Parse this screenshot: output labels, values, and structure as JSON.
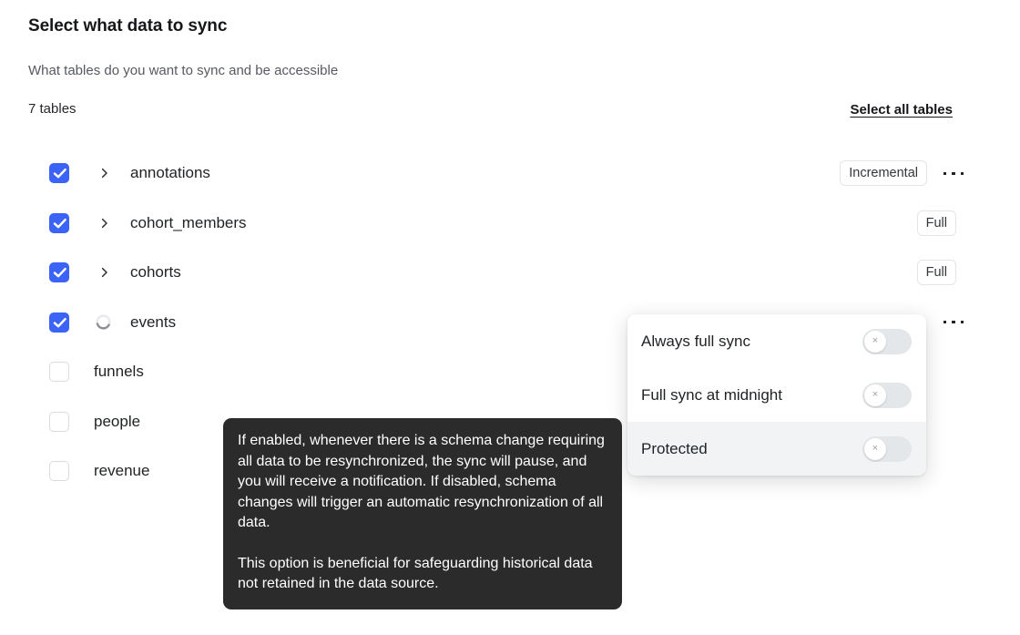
{
  "header": {
    "title": "Select what data to sync",
    "subtitle": "What tables do you want to sync and be accessible",
    "count_label": "7 tables",
    "select_all_label": "Select all tables"
  },
  "colors": {
    "checkbox_checked": "#3b63f6",
    "tooltip_bg": "#2b2b2b",
    "menu_hover_bg": "#f1f3f5",
    "toggle_track_off": "#e4e7ea"
  },
  "tables": [
    {
      "name": "annotations",
      "checked": true,
      "expander": "chevron-right-icon",
      "badge": "Incremental",
      "has_menu": true
    },
    {
      "name": "cohort_members",
      "checked": true,
      "expander": "chevron-right-icon",
      "badge": "Full",
      "has_menu": false
    },
    {
      "name": "cohorts",
      "checked": true,
      "expander": "chevron-right-icon",
      "badge": "Full",
      "has_menu": false
    },
    {
      "name": "events",
      "checked": true,
      "expander": "loading-spinner-icon",
      "badge": "",
      "has_menu": true
    },
    {
      "name": "funnels",
      "checked": false,
      "expander": "none",
      "badge": "",
      "has_menu": false
    },
    {
      "name": "people",
      "checked": false,
      "expander": "none",
      "badge": "",
      "has_menu": false
    },
    {
      "name": "revenue",
      "checked": false,
      "expander": "none",
      "badge": "",
      "has_menu": false
    }
  ],
  "popover": {
    "items": [
      {
        "label": "Always full sync",
        "toggle_on": false,
        "hovered": false
      },
      {
        "label": "Full sync at midnight",
        "toggle_on": false,
        "hovered": false
      },
      {
        "label": "Protected",
        "toggle_on": false,
        "hovered": true
      }
    ],
    "toggle_off_glyph": "×"
  },
  "tooltip": {
    "paragraph1": "If enabled, whenever there is a schema change requiring all data to be resynchronized, the sync will pause, and you will receive a notification. If disabled, schema changes will trigger an automatic resynchronization of all data.",
    "paragraph2": "This option is beneficial for safeguarding historical data not retained in the data source."
  }
}
